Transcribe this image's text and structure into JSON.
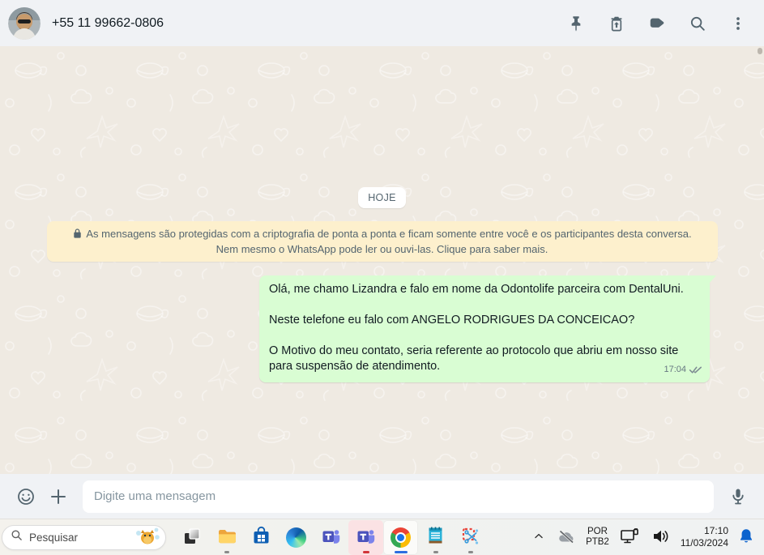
{
  "header": {
    "contact_name": "+55 11 99662-0806",
    "action_icons": [
      "pin-icon",
      "trash-restore-icon",
      "label-icon",
      "search-icon",
      "kebab-menu-icon"
    ]
  },
  "chat": {
    "date_divider": "HOJE",
    "encryption_notice": "As mensagens são protegidas com a criptografia de ponta a ponta e ficam somente entre você e os participantes desta conversa. Nem mesmo o WhatsApp pode ler ou ouvi-las. Clique para saber mais.",
    "messages": [
      {
        "direction": "outgoing",
        "paragraphs": [
          "Olá, me chamo Lizandra e falo em nome da Odontolife parceira com DentalUni.",
          "Neste telefone eu falo com ANGELO RODRIGUES DA CONCEICAO?",
          "O Motivo do meu contato, seria referente ao protocolo que abriu em nosso site para suspensão de atendimento."
        ],
        "time": "17:04",
        "status": "delivered-double-check-gray"
      }
    ]
  },
  "composer": {
    "placeholder": "Digite uma mensagem",
    "icons": [
      "emoji-icon",
      "plus-icon",
      "mic-icon"
    ]
  },
  "taskbar": {
    "search_label": "Pesquisar",
    "apps": [
      "task-view",
      "file-explorer",
      "microsoft-store",
      "edge",
      "teams",
      "teams-alert",
      "chrome",
      "notepad",
      "snipping-tool"
    ],
    "running_apps": [
      "file-explorer",
      "teams-alert",
      "chrome",
      "notepad",
      "snipping-tool"
    ],
    "active_app": "chrome",
    "tray": {
      "language_line1": "POR",
      "language_line2": "PTB2",
      "time": "17:10",
      "date": "11/03/2024",
      "icons": [
        "chevron-up-icon",
        "onedrive-offline-icon",
        "ethernet-icon",
        "volume-icon",
        "notification-bell-icon"
      ]
    }
  },
  "colors": {
    "header_bg": "#f0f2f5",
    "chat_bg": "#efeae2",
    "bubble_outgoing": "#d9fdd3",
    "encryption_banner_bg": "#fdf0cd",
    "text_primary": "#111b21",
    "text_secondary": "#54656f",
    "text_muted": "#8696a0",
    "checkmark_gray": "#7d8b92",
    "bell_blue": "#0b63ce",
    "teams_alert_highlight": "#fbe2e4",
    "active_underline_blue": "#2b6de0"
  }
}
